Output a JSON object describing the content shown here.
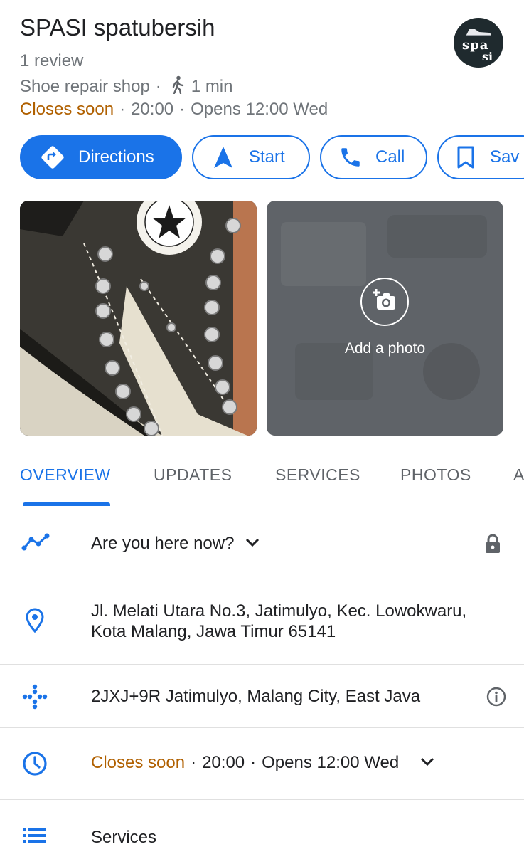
{
  "place": {
    "name": "SPASI spatubersih",
    "logo_text_1": "spa",
    "logo_text_2": "si",
    "reviews": "1 review",
    "category": "Shoe repair shop",
    "walk_time": "1 min",
    "hours_status": "Closes soon",
    "closing_time": "20:00",
    "opens_next": "Opens 12:00 Wed",
    "separator": "·"
  },
  "actions": {
    "directions": "Directions",
    "start": "Start",
    "call": "Call",
    "save": "Sav"
  },
  "photos": {
    "add_photo": "Add a photo"
  },
  "tabs": [
    "OVERVIEW",
    "UPDATES",
    "SERVICES",
    "PHOTOS",
    "A"
  ],
  "info": {
    "here_now": "Are you here now?",
    "address": "Jl. Melati Utara No.3, Jatimulyo, Kec. Lowokwaru, Kota Malang, Jawa Timur 65141",
    "plus_code": "2JXJ+9R Jatimulyo, Malang City, East Java",
    "hours_status": "Closes soon",
    "closing_time": "20:00",
    "opens_next": "Opens 12:00 Wed",
    "services": "Services"
  },
  "colors": {
    "accent": "#1a73e8",
    "warning": "#b06000",
    "muted": "#70757a"
  }
}
